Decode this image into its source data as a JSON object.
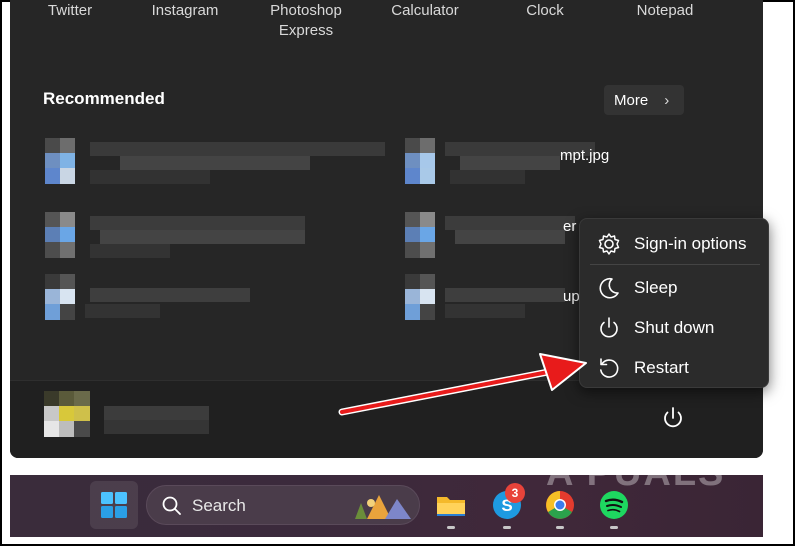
{
  "start_menu": {
    "pinned_apps": [
      {
        "label": "Twitter"
      },
      {
        "label": "Instagram"
      },
      {
        "label": "Photoshop Express"
      },
      {
        "label": "Calculator"
      },
      {
        "label": "Clock"
      },
      {
        "label": "Notepad"
      }
    ],
    "recommended": {
      "title": "Recommended",
      "more_label": "More",
      "visible_fragments": {
        "item_2": "mpt.jpg",
        "item_4": "er",
        "item_6": "up"
      }
    },
    "power_menu": {
      "items": [
        {
          "label": "Sign-in options",
          "icon": "gear-icon"
        },
        {
          "label": "Sleep",
          "icon": "moon-icon"
        },
        {
          "label": "Shut down",
          "icon": "power-icon"
        },
        {
          "label": "Restart",
          "icon": "restart-icon"
        }
      ]
    }
  },
  "taskbar": {
    "search_placeholder": "Search",
    "skype_badge": "3"
  },
  "watermark": "A PUALS",
  "colors": {
    "annotation_arrow": "#e81b1b",
    "menu_bg": "#262626",
    "taskbar_bg": "#3b2a3c",
    "windows_blue": "#4cc2ff"
  }
}
